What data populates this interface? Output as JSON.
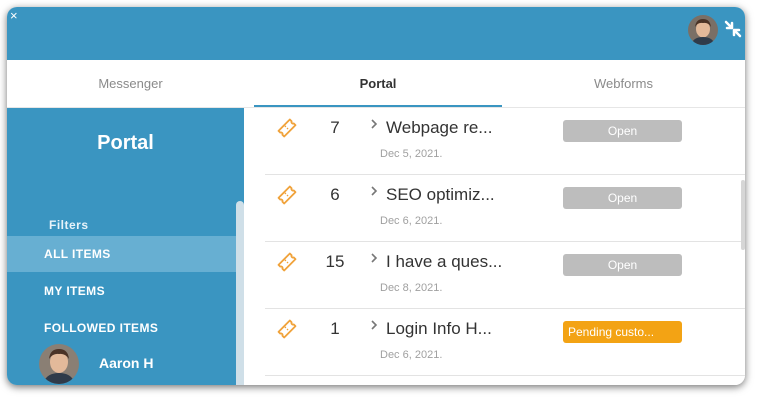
{
  "window": {
    "close_glyph": "×"
  },
  "tabs": [
    {
      "label": "Messenger"
    },
    {
      "label": "Portal"
    },
    {
      "label": "Webforms"
    }
  ],
  "sidebar": {
    "title": "Portal",
    "filters_label": "Filters",
    "items": [
      {
        "label": "ALL ITEMS"
      },
      {
        "label": "MY ITEMS"
      },
      {
        "label": "FOLLOWED ITEMS"
      }
    ],
    "user_name": "Aaron H"
  },
  "tickets": [
    {
      "number": "7",
      "title": "Webpage re...",
      "date": "Dec 5, 2021.",
      "status": "Open"
    },
    {
      "number": "6",
      "title": "SEO optimiz...",
      "date": "Dec 6, 2021.",
      "status": "Open"
    },
    {
      "number": "15",
      "title": "I have a ques...",
      "date": "Dec 8, 2021.",
      "status": "Open"
    },
    {
      "number": "1",
      "title": "Login Info H...",
      "date": "Dec 6, 2021.",
      "status": "Pending custo..."
    }
  ],
  "colors": {
    "header_blue": "#3a95c1",
    "sidebar_active": "#67afd2",
    "ticket_icon": "#f0a23a",
    "status_open": "#bdbdbd",
    "status_pending": "#f3a314"
  },
  "icons": {
    "close": "close-icon",
    "collapse": "collapse-icon",
    "ticket": "ticket-icon",
    "chevron": "chevron-right-icon"
  }
}
